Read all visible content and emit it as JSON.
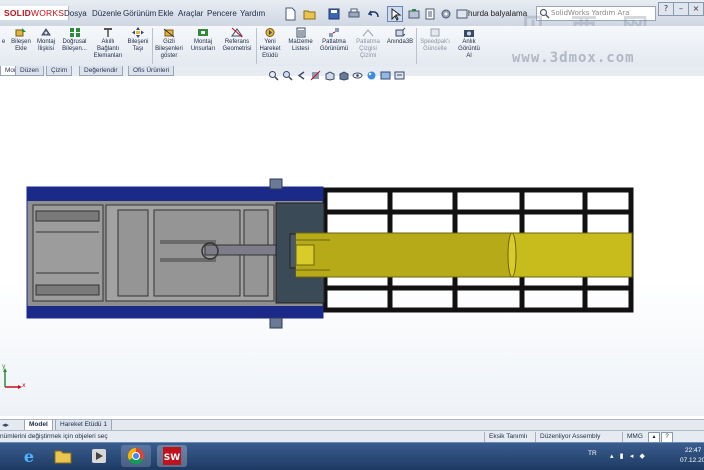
{
  "app": {
    "logo_solid": "SOLID",
    "logo_works": "WORKS",
    "document_name": "hurda balyalama",
    "search_placeholder": "SolidWorks Yardım Ara",
    "menu": [
      "Dosya",
      "Düzenle",
      "Görünüm",
      "Ekle",
      "Araçlar",
      "Pencere",
      "Yardım"
    ]
  },
  "watermark": {
    "text": "贝 西 网",
    "url": "www.3dmox.com"
  },
  "ribbon": {
    "buttons": [
      {
        "label": "Bileşen\nEkle",
        "icon": "insert-component-icon"
      },
      {
        "label": "Montaj\nİlişkisi",
        "icon": "mate-icon"
      },
      {
        "label": "Doğrusal\nBileşen...",
        "icon": "linear-pattern-icon"
      },
      {
        "label": "Akıllı\nBağlantı\nElemanları",
        "icon": "smart-fasteners-icon"
      },
      {
        "label": "Bileşeni\nTaşı",
        "icon": "move-component-icon"
      },
      {
        "label": "Gizli\nBileşenleri\ngöster",
        "icon": "show-hidden-icon"
      },
      {
        "label": "Montaj\nUnsurları",
        "icon": "assembly-features-icon"
      },
      {
        "label": "Referans\nGeometrisi",
        "icon": "reference-geometry-icon"
      },
      {
        "label": "Yeni\nHareket\nEtüdü",
        "icon": "motion-study-icon"
      },
      {
        "label": "Malzeme\nListesi",
        "icon": "bom-icon"
      },
      {
        "label": "Patlatma\nGörünümü",
        "icon": "exploded-view-icon"
      },
      {
        "label": "Patlatma\nÇizgisi\nÇizimi",
        "icon": "explode-line-icon"
      },
      {
        "label": "Anında3B",
        "icon": "instant3d-icon"
      },
      {
        "label": "Speedpak'ı\nGüncelle",
        "icon": "speedpak-icon"
      },
      {
        "label": "Anlık\nGörüntü\nAl",
        "icon": "snapshot-icon"
      }
    ],
    "edge_label": "e"
  },
  "tabs": [
    "Montaj",
    "Düzen",
    "Çizim",
    "Değerlendir",
    "Ofis Ürünleri"
  ],
  "active_tab": "Montaj",
  "viewport": {
    "triad_x": "x",
    "triad_y": "y"
  },
  "model_tabs": [
    "Model",
    "Hareket Etüdü 1"
  ],
  "active_model_tab": "Model",
  "status": {
    "message": "nümlerini değiştirmek için objeleri seç",
    "defined": "Eksik Tanımlı",
    "editing": "Düzenliyor Assembly",
    "units": "MMG",
    "help": "?"
  },
  "taskbar": {
    "lang": "TR",
    "time": "22:47",
    "date": "07.12.20"
  },
  "colors": {
    "frame_blue": "#1b2a88",
    "frame_gray": "#8e8e8e",
    "cylinder_yellow": "#c8bb1c",
    "rail_black": "#111111"
  }
}
